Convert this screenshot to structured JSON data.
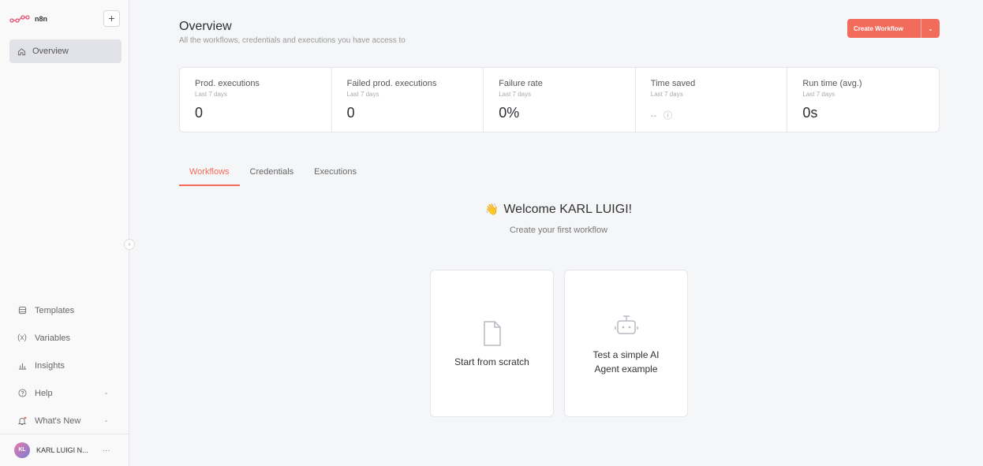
{
  "sidebar": {
    "logo_text": "n8n",
    "add_label": "+",
    "overview_label": "Overview",
    "bottom_items": [
      {
        "label": "Templates",
        "icon": "templates-icon"
      },
      {
        "label": "Variables",
        "icon": "variables-icon"
      },
      {
        "label": "Insights",
        "icon": "insights-icon"
      },
      {
        "label": "Help",
        "icon": "help-icon"
      },
      {
        "label": "What's New",
        "icon": "bell-icon"
      }
    ],
    "user": {
      "initials": "KL",
      "name": "KARL LUIGI N..."
    }
  },
  "header": {
    "title": "Overview",
    "subtitle": "All the workflows, credentials and executions you have access to",
    "create_button": "Create Workflow"
  },
  "stats": [
    {
      "label": "Prod. executions",
      "period": "Last 7 days",
      "value": "0"
    },
    {
      "label": "Failed prod. executions",
      "period": "Last 7 days",
      "value": "0"
    },
    {
      "label": "Failure rate",
      "period": "Last 7 days",
      "value": "0%"
    },
    {
      "label": "Time saved",
      "period": "Last 7 days",
      "value": "--"
    },
    {
      "label": "Run time (avg.)",
      "period": "Last 7 days",
      "value": "0s"
    }
  ],
  "tabs": [
    {
      "label": "Workflows",
      "active": true
    },
    {
      "label": "Credentials",
      "active": false
    },
    {
      "label": "Executions",
      "active": false
    }
  ],
  "welcome": {
    "title": "Welcome KARL LUIGI!",
    "subtitle": "Create your first workflow"
  },
  "cards": [
    {
      "label": "Start from scratch",
      "icon": "file-icon"
    },
    {
      "label": "Test a simple AI Agent example",
      "icon": "robot-icon"
    }
  ],
  "colors": {
    "accent": "#f36b5a",
    "sidebar_bg": "#f9f9fa",
    "page_bg": "#f5f6f8"
  }
}
